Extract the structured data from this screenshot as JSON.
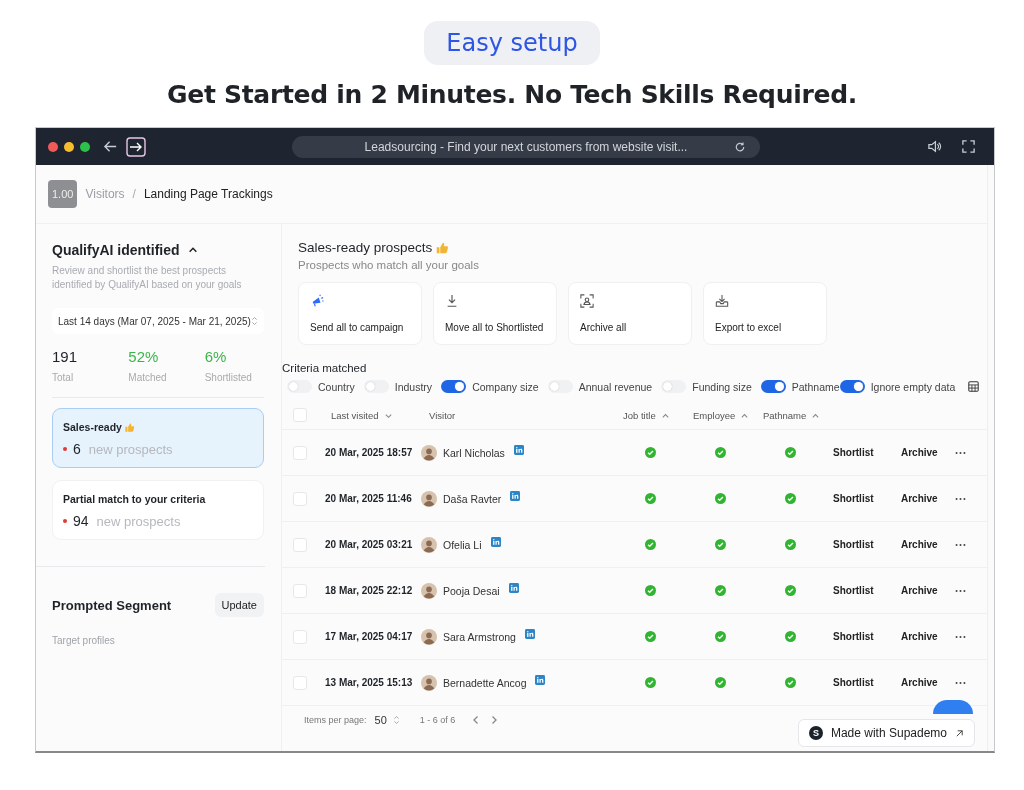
{
  "hero": {
    "pill": "Easy setup",
    "heading": "Get Started in 2 Minutes. No Tech Skills Required."
  },
  "browser": {
    "address": "Leadsourcing - Find your next customers from website visit..."
  },
  "badge": "1.00",
  "breadcrumb": [
    "Visitors",
    "Landing Page Trackings"
  ],
  "breadcrumb_separator": "/",
  "sidebar": {
    "title": "QualifyAI identified",
    "expanded": true,
    "description": "Review and shortlist the best prospects identified by QualifyAI based on your goals",
    "date_range": "Last 14 days (Mar 07, 2025 - Mar 21, 2025)",
    "stats": [
      {
        "value": "191",
        "label": "Total",
        "color": "#1f2328"
      },
      {
        "value": "52%",
        "label": "Matched",
        "color": "#3bb54a"
      },
      {
        "value": "6%",
        "label": "Shortlisted",
        "color": "#3bb54a"
      }
    ],
    "segments": [
      {
        "title": "Sales-ready",
        "thumb": true,
        "count": "6",
        "suffix": "new prospects",
        "selected": true
      },
      {
        "title": "Partial match to your criteria",
        "thumb": false,
        "count": "94",
        "suffix": "new prospects",
        "selected": false
      }
    ],
    "prompted": {
      "title": "Prompted Segment",
      "button": "Update",
      "subtitle": "Target profiles"
    }
  },
  "main": {
    "title": "Sales-ready prospects",
    "subtitle": "Prospects who match all your goals",
    "actions": [
      {
        "kind": "campaign",
        "label": "Send all to campaign"
      },
      {
        "kind": "download",
        "label": "Move all to Shortlisted"
      },
      {
        "kind": "archive",
        "label": "Archive all"
      },
      {
        "kind": "export",
        "label": "Export to excel"
      }
    ],
    "criteria_title": "Criteria matched",
    "criteria": [
      {
        "label": "Country",
        "on": false
      },
      {
        "label": "Industry",
        "on": false
      },
      {
        "label": "Company size",
        "on": true
      },
      {
        "label": "Annual revenue",
        "on": false
      },
      {
        "label": "Funding size",
        "on": false
      },
      {
        "label": "Pathname",
        "on": true
      },
      {
        "label": "Ignore empty data",
        "on": true
      }
    ],
    "select_all_checked": false,
    "columns": [
      {
        "label": "Last visited",
        "sort_ascending": false
      },
      {
        "label": "Visitor"
      },
      {
        "label": "Job title",
        "sort_ascending": true
      },
      {
        "label": "Employee",
        "sort_ascending": true
      },
      {
        "label": "Pathname",
        "sort_ascending": true
      }
    ],
    "rows": [
      {
        "checked": false,
        "date": "20 Mar, 2025 18:57",
        "name": "Karl Nicholas",
        "job_title": true,
        "employee": true,
        "pathname": true,
        "shortlist": "Shortlist",
        "archive": "Archive"
      },
      {
        "checked": false,
        "date": "20 Mar, 2025 11:46",
        "name": "Daša Ravter",
        "job_title": true,
        "employee": true,
        "pathname": true,
        "shortlist": "Shortlist",
        "archive": "Archive"
      },
      {
        "checked": false,
        "date": "20 Mar, 2025 03:21",
        "name": "Ofelia Li",
        "job_title": true,
        "employee": true,
        "pathname": true,
        "shortlist": "Shortlist",
        "archive": "Archive"
      },
      {
        "checked": false,
        "date": "18 Mar, 2025 22:12",
        "name": "Pooja Desai",
        "job_title": true,
        "employee": true,
        "pathname": true,
        "shortlist": "Shortlist",
        "archive": "Archive"
      },
      {
        "checked": false,
        "date": "17 Mar, 2025 04:17",
        "name": "Sara Armstrong",
        "job_title": true,
        "employee": true,
        "pathname": true,
        "shortlist": "Shortlist",
        "archive": "Archive"
      },
      {
        "checked": false,
        "date": "13 Mar, 2025 15:13",
        "name": "Bernadette Ancog",
        "job_title": true,
        "employee": true,
        "pathname": true,
        "shortlist": "Shortlist",
        "archive": "Archive"
      }
    ],
    "pager": {
      "label": "Items per page:",
      "per_page": "50",
      "range": "1 - 6 of 6"
    }
  },
  "supademo": {
    "logo": "S",
    "label": "Made with Supademo"
  }
}
